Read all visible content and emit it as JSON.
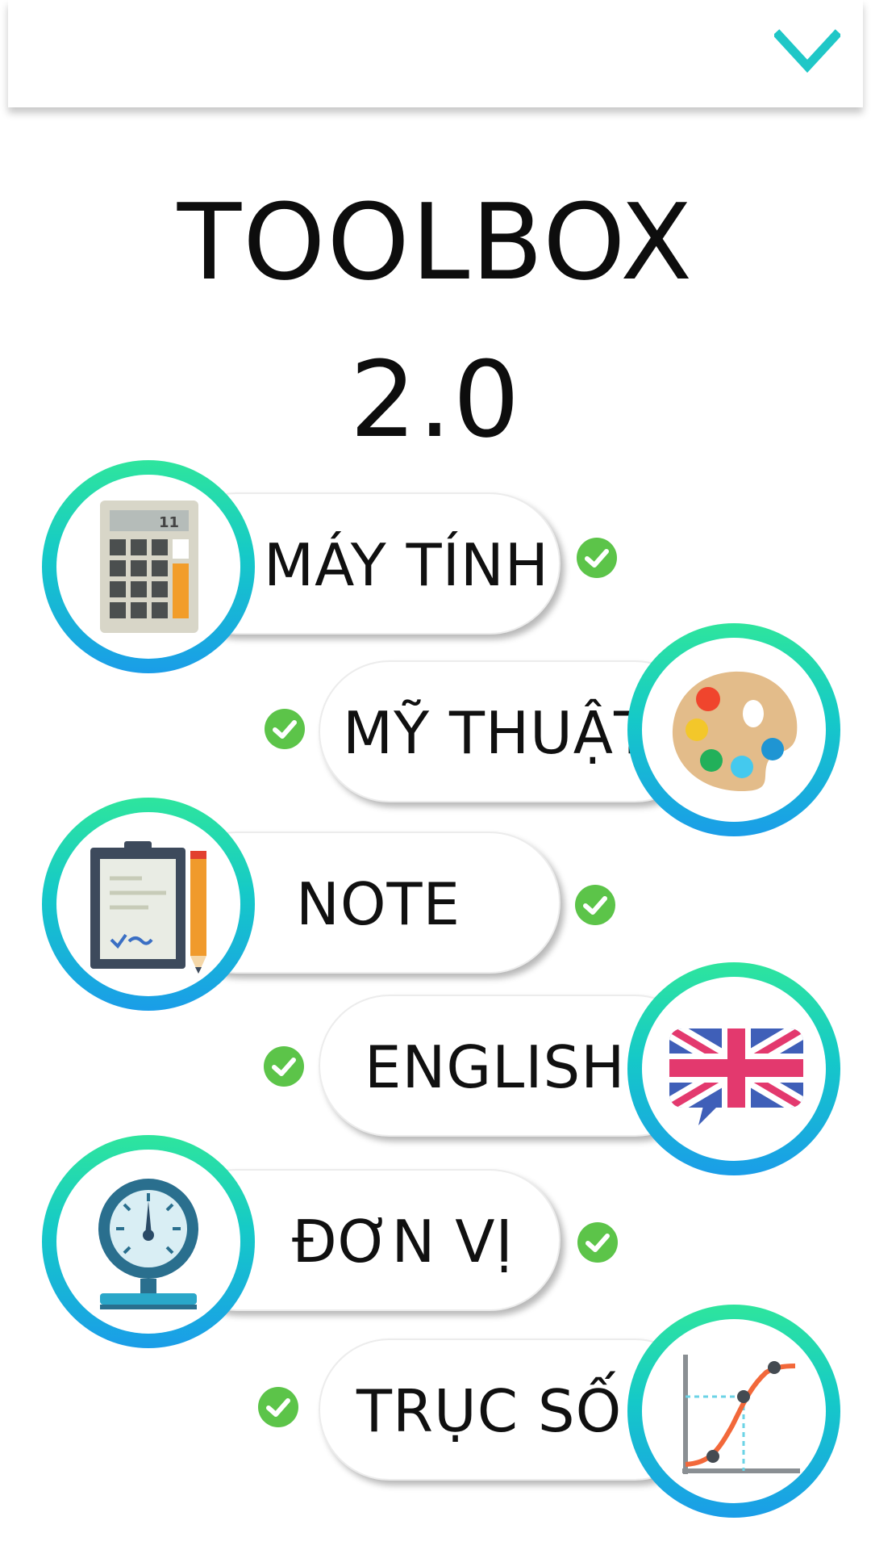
{
  "header": {
    "collapse_icon": "chevron-down-icon",
    "accent": "#1fc7c7"
  },
  "title": {
    "line1": "TOOLBOX",
    "line2": "2.0"
  },
  "tools": [
    {
      "label": "MÁY TÍNH",
      "icon": "calculator-icon",
      "status_icon": "check-circle-icon"
    },
    {
      "label": "MỸ THUẬT",
      "icon": "palette-icon",
      "status_icon": "check-circle-icon"
    },
    {
      "label": "NOTE",
      "icon": "clipboard-icon",
      "status_icon": "check-circle-icon"
    },
    {
      "label": "ENGLISH",
      "icon": "uk-flag-icon",
      "status_icon": "check-circle-icon"
    },
    {
      "label": "ĐƠN VỊ",
      "icon": "pressure-gauge-icon",
      "status_icon": "check-circle-icon"
    },
    {
      "label": "TRỤC SỐ",
      "icon": "number-line-chart-icon",
      "status_icon": "check-circle-icon"
    }
  ],
  "colors": {
    "ring_top": "#2ee59d",
    "ring_bottom": "#1a9de8",
    "check": "#5cc449"
  }
}
